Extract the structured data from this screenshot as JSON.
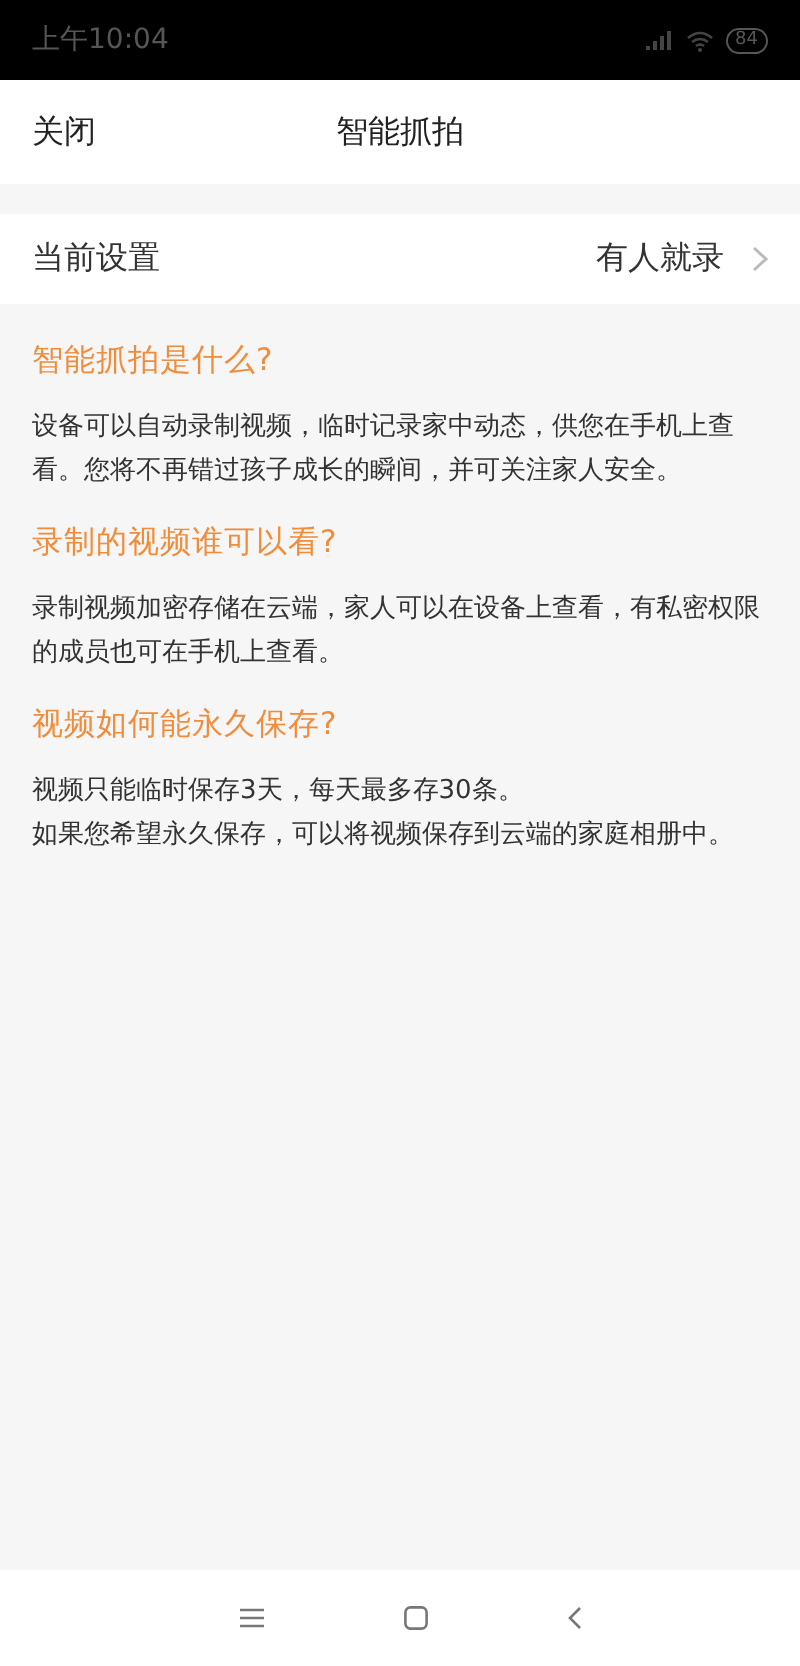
{
  "status_bar": {
    "time": "上午10:04",
    "battery": "84"
  },
  "header": {
    "close": "关闭",
    "title": "智能抓拍"
  },
  "setting": {
    "label": "当前设置",
    "value": "有人就录"
  },
  "sections": [
    {
      "heading": "智能抓拍是什么?",
      "paragraphs": [
        "设备可以自动录制视频，临时记录家中动态，供您在手机上查看。您将不再错过孩子成长的瞬间，并可关注家人安全。"
      ]
    },
    {
      "heading": "录制的视频谁可以看?",
      "paragraphs": [
        "录制视频加密存储在云端，家人可以在设备上查看，有私密权限的成员也可在手机上查看。"
      ]
    },
    {
      "heading": "视频如何能永久保存?",
      "paragraphs": [
        "视频只能临时保存3天，每天最多存30条。",
        "如果您希望永久保存，可以将视频保存到云端的家庭相册中。"
      ]
    }
  ]
}
